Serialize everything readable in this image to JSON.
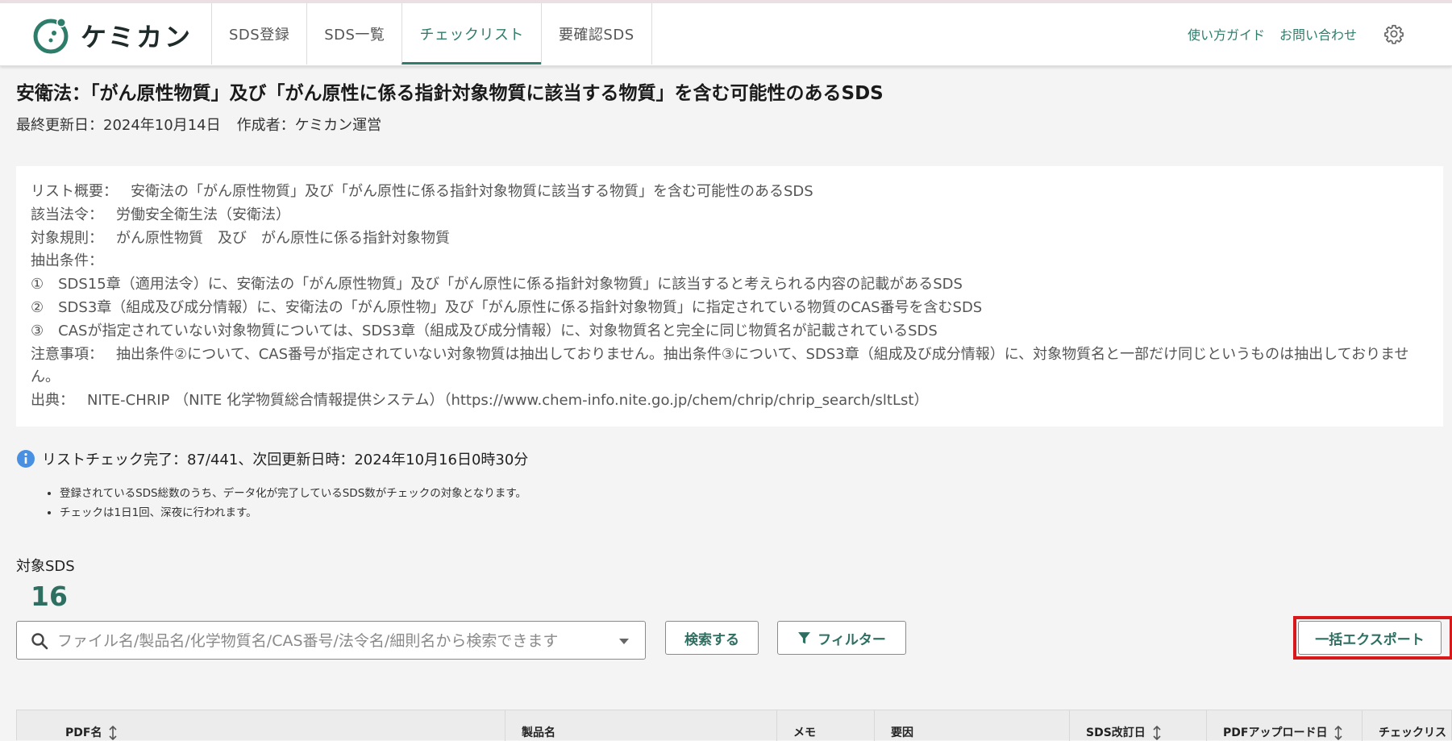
{
  "app": {
    "name": "ケミカン",
    "brand_color": "#2e7d6b"
  },
  "nav": {
    "tabs": [
      {
        "label": "SDS登録"
      },
      {
        "label": "SDS一覧"
      },
      {
        "label": "チェックリスト",
        "active": true
      },
      {
        "label": "要確認SDS"
      }
    ],
    "links": {
      "guide": "使い方ガイド",
      "contact": "お問い合わせ"
    },
    "settings_icon": "gear-icon"
  },
  "page": {
    "title": "安衛法：「がん原性物質」及び「がん原性に係る指針対象物質に該当する物質」を含む可能性のあるSDS",
    "updated": "最終更新日：2024年10月14日",
    "author": "作成者：ケミカン運営"
  },
  "description": {
    "overview_label": "リスト概要：",
    "overview": "安衛法の「がん原性物質」及び「がん原性に係る指針対象物質に該当する物質」を含む可能性のあるSDS",
    "law_label": "該当法令：",
    "law": "労働安全衛生法（安衛法）",
    "rule_label": "対象規則：",
    "rule": "がん原性物質　及び　がん原性に係る指針対象物質",
    "condition_label": "抽出条件：",
    "conditions": [
      "①　SDS15章（適用法令）に、安衛法の「がん原性物質」及び「がん原性に係る指針対象物質」に該当すると考えられる内容の記載があるSDS",
      "②　SDS3章（組成及び成分情報）に、安衛法の「がん原性物」及び「がん原性に係る指針対象物質」に指定されている物質のCAS番号を含むSDS",
      "③　CASが指定されていない対象物質については、SDS3章（組成及び成分情報）に、対象物質名と完全に同じ物質名が記載されているSDS"
    ],
    "notes_label": "注意事項：",
    "notes": "抽出条件②について、CAS番号が指定されていない対象物質は抽出しておりません。抽出条件③について、SDS3章（組成及び成分情報）に、対象物質名と一部だけ同じというものは抽出しておりません。",
    "source_label": "出典：",
    "source": "NITE-CHRIP （NITE 化学物質総合情報提供システム）（https://www.chem-info.nite.go.jp/chem/chrip/chrip_search/sltLst）"
  },
  "status": {
    "text": "リストチェック完了：87/441、次回更新日時：2024年10月16日0時30分",
    "notes": [
      "登録されているSDS総数のうち、データ化が完了しているSDS数がチェックの対象となります。",
      "チェックは1日1回、深夜に行われます。"
    ],
    "info_color": "#4a90e2"
  },
  "target": {
    "label": "対象SDS",
    "count": "16"
  },
  "search": {
    "placeholder": "ファイル名/製品名/化学物質名/CAS番号/法令名/細則名から検索できます",
    "value": "",
    "search_button": "検索する",
    "filter_button": "フィルター",
    "export_button": "一括エクスポート",
    "highlight_color": "#d7191c"
  },
  "table": {
    "columns": [
      {
        "label": "PDF名",
        "sortable": true
      },
      {
        "label": "製品名",
        "sortable": false
      },
      {
        "label": "メモ",
        "sortable": false
      },
      {
        "label": "要因",
        "sortable": false
      },
      {
        "label": "SDS改訂日",
        "sortable": true
      },
      {
        "label": "PDFアップロード日",
        "sortable": true
      },
      {
        "label": "チェックリス",
        "sortable": false
      }
    ]
  }
}
